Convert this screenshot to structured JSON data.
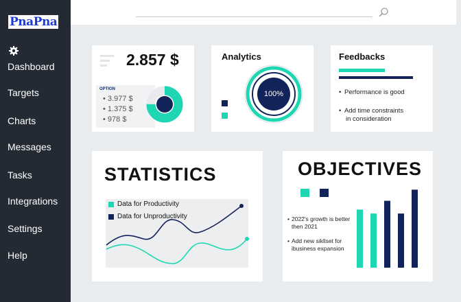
{
  "app": {
    "logo": "PnaPna"
  },
  "sidebar": {
    "items": [
      {
        "label": "Dashboard"
      },
      {
        "label": "Targets"
      },
      {
        "label": "Charts"
      },
      {
        "label": "Messages"
      },
      {
        "label": "Tasks"
      },
      {
        "label": "Integrations"
      },
      {
        "label": "Settings"
      },
      {
        "label": "Help"
      }
    ]
  },
  "colors": {
    "accent": "#1ed6b1",
    "navy": "#12235a",
    "sidebar": "#232a34"
  },
  "balance_card": {
    "amount": "2.857 $",
    "option_label": "OPTION",
    "options": [
      "3.977 $",
      "1.375 $",
      "978 $"
    ],
    "donut_fraction": 0.75
  },
  "analytics_card": {
    "title": "Analytics",
    "percent": "100%"
  },
  "feedback_card": {
    "title": "Feedbacks",
    "bullets": [
      "Performance is good",
      "Add time constraints",
      "in consideration"
    ]
  },
  "statistics_card": {
    "title": "STATISTICS",
    "legend": [
      "Data for Productivity",
      "Data for Unproductivity"
    ]
  },
  "objectives_card": {
    "title": "OBJECTIVES",
    "bullets": [
      [
        "2022's growth is better",
        "then 2021"
      ],
      [
        "Add new sikllset for",
        "ibusiness expansion"
      ]
    ],
    "bar_levels": [
      0.73,
      0.68,
      0.84,
      0.68,
      0.98
    ]
  }
}
